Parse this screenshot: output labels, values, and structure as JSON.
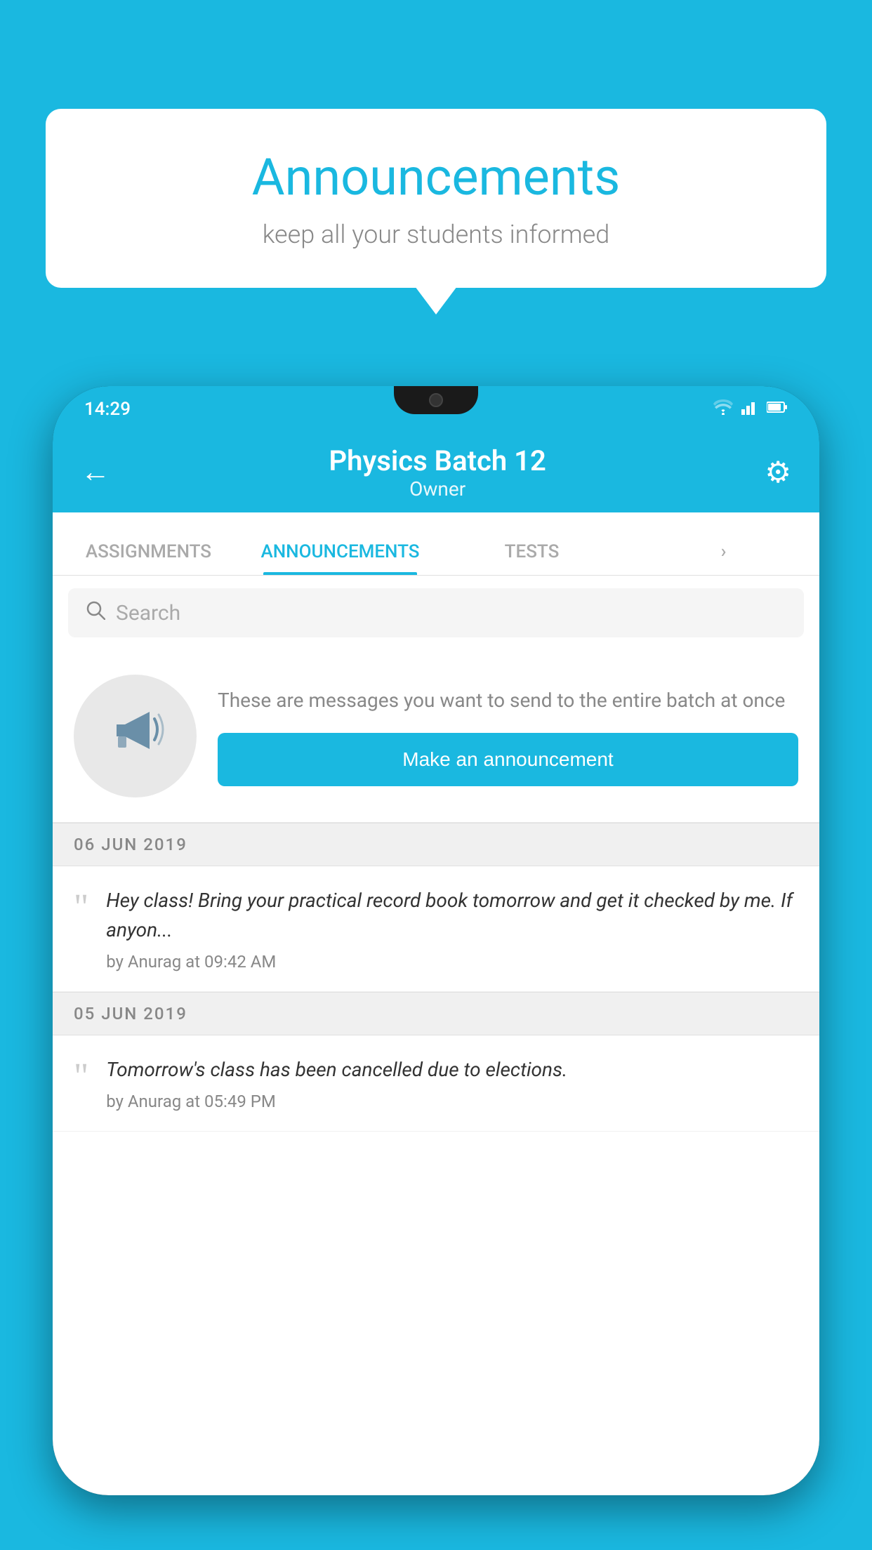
{
  "background_color": "#1ab8e0",
  "speech_bubble": {
    "title": "Announcements",
    "subtitle": "keep all your students informed"
  },
  "phone": {
    "status_bar": {
      "time": "14:29",
      "wifi": "▼",
      "signal": "▲",
      "battery": "▮"
    },
    "header": {
      "back_label": "←",
      "title": "Physics Batch 12",
      "subtitle": "Owner",
      "settings_label": "⚙"
    },
    "tabs": [
      {
        "label": "ASSIGNMENTS",
        "active": false
      },
      {
        "label": "ANNOUNCEMENTS",
        "active": true
      },
      {
        "label": "TESTS",
        "active": false
      },
      {
        "label": "›",
        "active": false
      }
    ],
    "search": {
      "placeholder": "Search"
    },
    "announcement_placeholder": {
      "description": "These are messages you want to send to the entire batch at once",
      "button_label": "Make an announcement"
    },
    "date_groups": [
      {
        "date": "06  JUN  2019",
        "items": [
          {
            "text": "Hey class! Bring your practical record book tomorrow and get it checked by me. If anyon...",
            "meta": "by Anurag at 09:42 AM"
          }
        ]
      },
      {
        "date": "05  JUN  2019",
        "items": [
          {
            "text": "Tomorrow's class has been cancelled due to elections.",
            "meta": "by Anurag at 05:49 PM"
          }
        ]
      }
    ]
  }
}
